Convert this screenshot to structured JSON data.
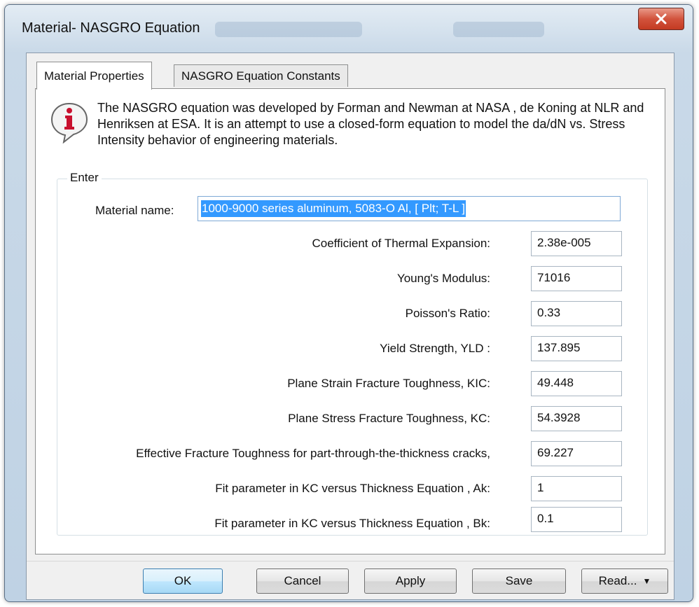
{
  "window": {
    "title": "Material- NASGRO Equation",
    "close_glyph": "X"
  },
  "tabs": [
    {
      "label": "Material Properties",
      "active": true
    },
    {
      "label": "NASGRO Equation Constants",
      "active": false
    }
  ],
  "info": {
    "icon": "info-icon",
    "text": "The NASGRO equation was developed by Forman and Newman at NASA , de Koning at NLR and Henriksen at ESA. It is an attempt to use a closed-form equation to model the da/dN vs. Stress Intensity behavior of engineering materials."
  },
  "group": {
    "label": "Enter",
    "material_name_label": "Material name:",
    "material_name_value": "1000-9000 series aluminum,  5083-O Al, [ Plt; T-L ]",
    "fields": [
      {
        "label": "Coefficient of Thermal Expansion:",
        "value": "2.38e-005"
      },
      {
        "label": "Young's Modulus:",
        "value": "71016"
      },
      {
        "label": "Poisson's  Ratio:",
        "value": "0.33"
      },
      {
        "label": "Yield Strength, YLD :",
        "value": "137.895"
      },
      {
        "label": "Plane Strain Fracture Toughness, KIC:",
        "value": "49.448"
      },
      {
        "label": "Plane Stress Fracture Toughness, KC:",
        "value": "54.3928"
      },
      {
        "label": "Effective Fracture Toughness for part-through-the-thickness cracks,",
        "value": "69.227"
      },
      {
        "label": "Fit parameter in KC  versus Thickness Equation , Ak:",
        "value": "1"
      },
      {
        "label": "Fit parameter in KC  versus Thickness Equation , Bk:",
        "value": "0.1"
      }
    ]
  },
  "buttons": {
    "ok": "OK",
    "cancel": "Cancel",
    "apply": "Apply",
    "save": "Save",
    "read": "Read...",
    "read_caret": "▼"
  },
  "colors": {
    "selection": "#3399ff",
    "close_button": "#c43b22",
    "info_icon": "#c8102e"
  }
}
